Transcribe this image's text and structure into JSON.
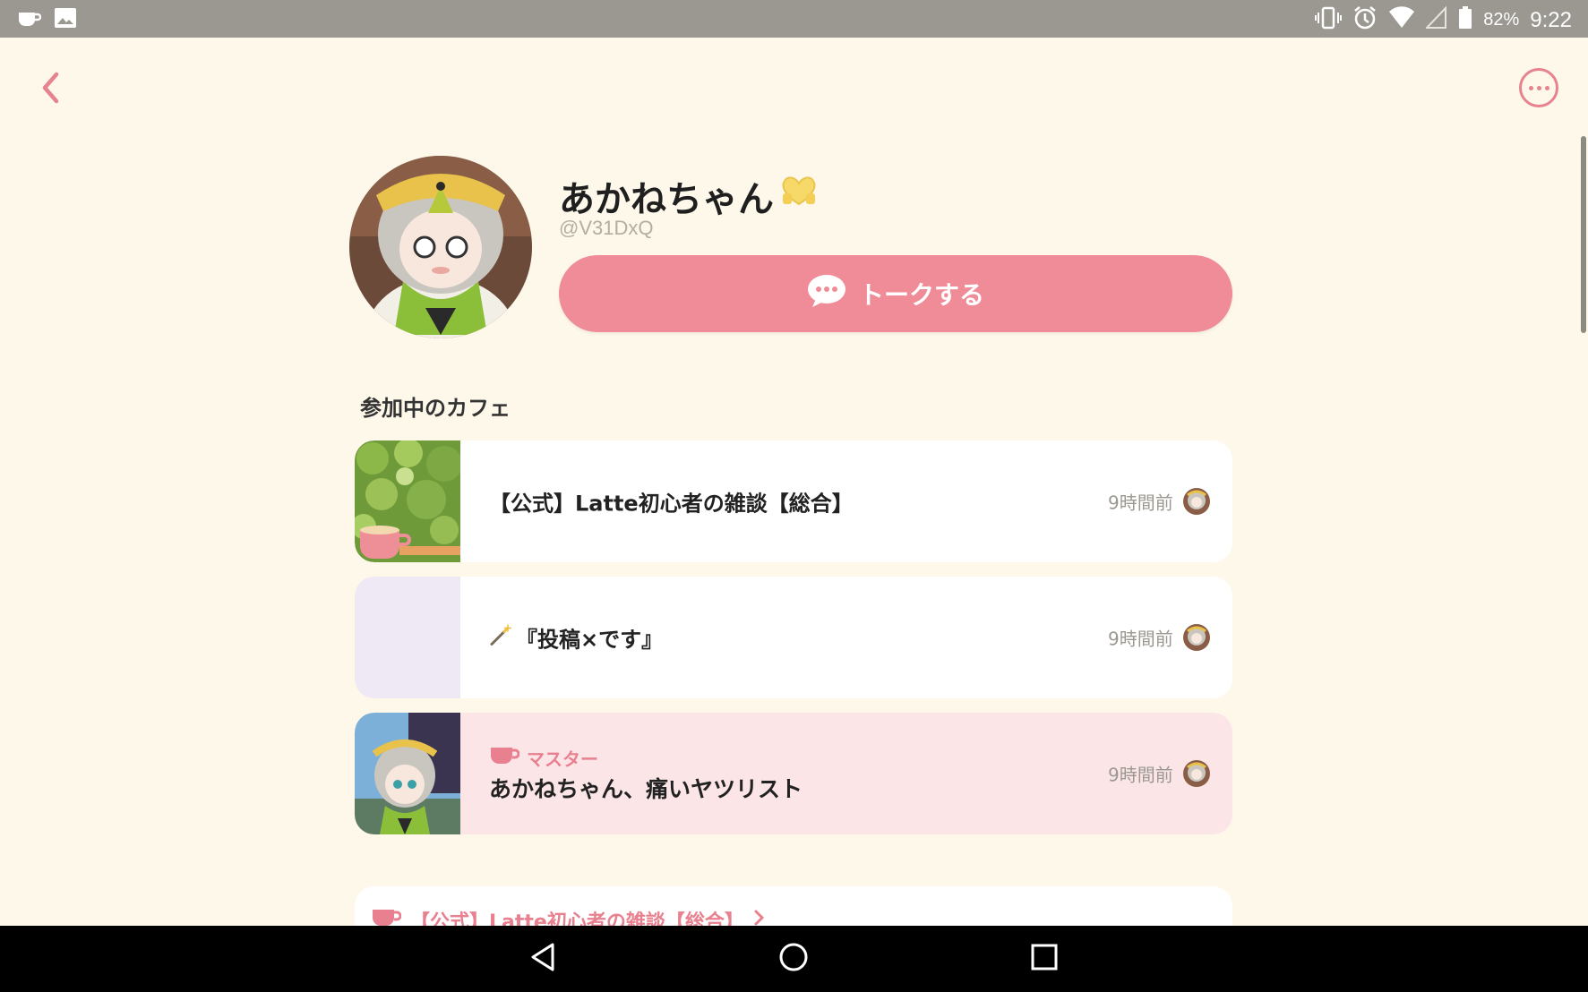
{
  "status_bar": {
    "battery_percent": "82%",
    "time": "9:22"
  },
  "profile": {
    "name": "あかねちゃん",
    "handle": "@V31DxQ",
    "talk_button_label": "トークする"
  },
  "cafes_section": {
    "title": "参加中のカフェ",
    "items": [
      {
        "name": "【公式】Latte初心者の雑談【総合】",
        "time": "9時間前"
      },
      {
        "name": "『投稿×です』",
        "time": "9時間前"
      },
      {
        "role_label": "マスター",
        "name": "あかねちゃん、痛いヤツリスト",
        "time": "9時間前"
      }
    ]
  },
  "post_preview": {
    "cafe_link": "【公式】Latte初心者の雑談【総合】"
  },
  "colors": {
    "accent": "#f08c98",
    "background": "#fdf8ea",
    "master_card": "#fbe5e7"
  }
}
